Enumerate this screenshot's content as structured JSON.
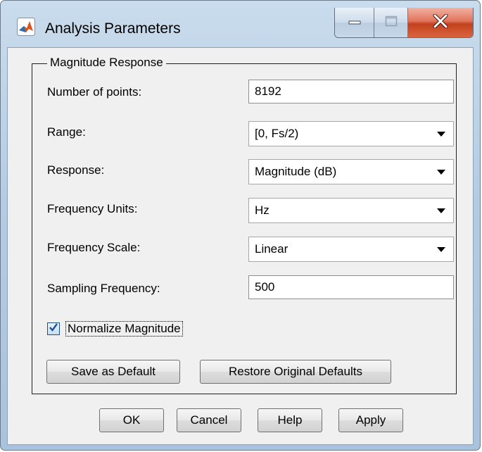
{
  "window": {
    "title": "Analysis Parameters",
    "icons": {
      "app": "matlab-icon",
      "minimize": "minimize-icon",
      "maximize": "maximize-icon",
      "close": "close-icon",
      "dropdown": "chevron-down-icon",
      "check": "checkmark-icon"
    },
    "colors": {
      "close_button": "#c3401e",
      "frame": "#b4cce3",
      "client": "#f0f0f0"
    }
  },
  "group": {
    "title": "Magnitude Response",
    "fields": {
      "num_points": {
        "label": "Number of points:",
        "value": "8192"
      },
      "range": {
        "label": "Range:",
        "selected": "[0, Fs/2)"
      },
      "response": {
        "label": "Response:",
        "selected": "Magnitude (dB)"
      },
      "freq_units": {
        "label": "Frequency Units:",
        "selected": "Hz"
      },
      "freq_scale": {
        "label": "Frequency Scale:",
        "selected": "Linear"
      },
      "sampling_freq": {
        "label": "Sampling Frequency:",
        "value": "500"
      }
    },
    "normalize": {
      "label": "Normalize Magnitude",
      "checked": true
    },
    "buttons": {
      "save_default": "Save as Default",
      "restore_defaults": "Restore Original Defaults"
    }
  },
  "footer": {
    "ok": "OK",
    "cancel": "Cancel",
    "help": "Help",
    "apply": "Apply"
  }
}
